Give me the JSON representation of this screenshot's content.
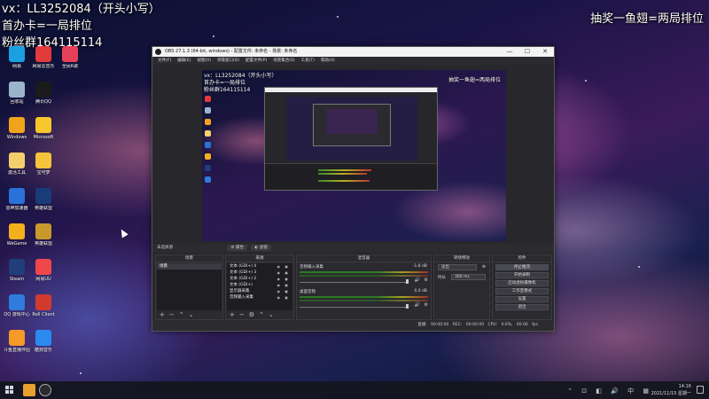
{
  "overlay": {
    "line1": "vx：LL3252084（开头小写）",
    "line2": "首办卡=一局排位",
    "line3": "粉丝群164115114",
    "top_right": "抽奖一鱼翅=两局排位"
  },
  "desktop_icons": [
    {
      "label": "网易",
      "color": "#1aa0e0",
      "col": 0,
      "row": 0
    },
    {
      "label": "网易云音乐",
      "color": "#e23a3a",
      "col": 1,
      "row": 0
    },
    {
      "label": "全民K歌",
      "color": "#e6405a",
      "col": 2,
      "row": 0
    },
    {
      "label": "回收站",
      "color": "#9bb4cc",
      "col": 0,
      "row": 1
    },
    {
      "label": "腾讯QQ",
      "color": "#1b1b1b",
      "col": 1,
      "row": 1
    },
    {
      "label": "Windows",
      "color": "#f2a31c",
      "col": 0,
      "row": 2
    },
    {
      "label": "Microsoft",
      "color": "#f7c82c",
      "col": 1,
      "row": 2
    },
    {
      "label": "激活工具",
      "color": "#f4d06c",
      "col": 0,
      "row": 3
    },
    {
      "label": "宝可梦",
      "color": "#f5c43a",
      "col": 1,
      "row": 3
    },
    {
      "label": "雷神加速器",
      "color": "#2a72d8",
      "col": 0,
      "row": 4
    },
    {
      "label": "英雄联盟",
      "color": "#1a3b7a",
      "col": 1,
      "row": 4
    },
    {
      "label": "WeGame",
      "color": "#f2b01c",
      "col": 0,
      "row": 5
    },
    {
      "label": "英雄联盟",
      "color": "#c79a2b",
      "col": 1,
      "row": 5
    },
    {
      "label": "Steam",
      "color": "#213d7a",
      "col": 0,
      "row": 6
    },
    {
      "label": "网易UU",
      "color": "#f04848",
      "col": 1,
      "row": 6
    },
    {
      "label": "QQ 游戏中心",
      "color": "#2f7bde",
      "col": 0,
      "row": 7
    },
    {
      "label": "Roll Client",
      "color": "#d33a2f",
      "col": 1,
      "row": 7
    },
    {
      "label": "斗鱼直播伴侣",
      "color": "#f59a28",
      "col": 0,
      "row": 8
    },
    {
      "label": "酷狗音乐",
      "color": "#2a8af0",
      "col": 1,
      "row": 8
    }
  ],
  "obs": {
    "title": "OBS 27.1.3 (64-bit, windows) - 配置文件: 未命名 - 场景: 未命名",
    "menu": [
      "文件(F)",
      "编辑(E)",
      "视图(V)",
      "停靠窗口(D)",
      "配置文件(P)",
      "场景集合(S)",
      "工具(T)",
      "帮助(H)"
    ],
    "window_buttons": {
      "min": "—",
      "max": "☐",
      "close": "✕"
    },
    "preview": {
      "overlay_line1": "vx：LL3252084（开头小写）",
      "overlay_line2": "首办卡=一局排位",
      "overlay_line3": "粉丝群164115114",
      "overlay_right": "抽奖一鱼翅=两局排位"
    },
    "toolbar": {
      "left": "未选择源",
      "properties": "属性",
      "filters": "滤镜"
    },
    "scenes": {
      "header": "场景",
      "items": [
        "场景"
      ]
    },
    "sources": {
      "header": "来源",
      "items": [
        {
          "name": "文本 (GDI+) 4"
        },
        {
          "name": "文本 (GDI+) 3"
        },
        {
          "name": "文本 (GDI+) 2"
        },
        {
          "name": "文本 (GDI+)"
        },
        {
          "name": "显示器采集"
        },
        {
          "name": "音频输入采集"
        }
      ]
    },
    "mixer": {
      "header": "混音器",
      "channels": [
        {
          "name": "音频输入采集",
          "db": "-1.8 dB",
          "vol_icon": "🔊",
          "gear": "⚙"
        },
        {
          "name": "桌面音频",
          "db": "0.0 dB",
          "vol_icon": "🔊",
          "gear": "⚙"
        }
      ]
    },
    "transitions": {
      "header": "转场特效",
      "type": "淡出",
      "duration_label": "时长",
      "duration": "300 ms"
    },
    "controls": {
      "header": "控件",
      "buttons": [
        "停止推流",
        "开始录制",
        "启动虚拟摄像机",
        "工作室模式",
        "设置",
        "退出"
      ]
    },
    "status": "直播: 00:00:00    REC: 00:00:00    CPU: 0.6%, 60.00 fps"
  },
  "taskbar": {
    "time": "14:16",
    "date": "2021/11/15 星期一",
    "tray": "⌃ ⊡ ◧ 🔊 中 ▦"
  }
}
